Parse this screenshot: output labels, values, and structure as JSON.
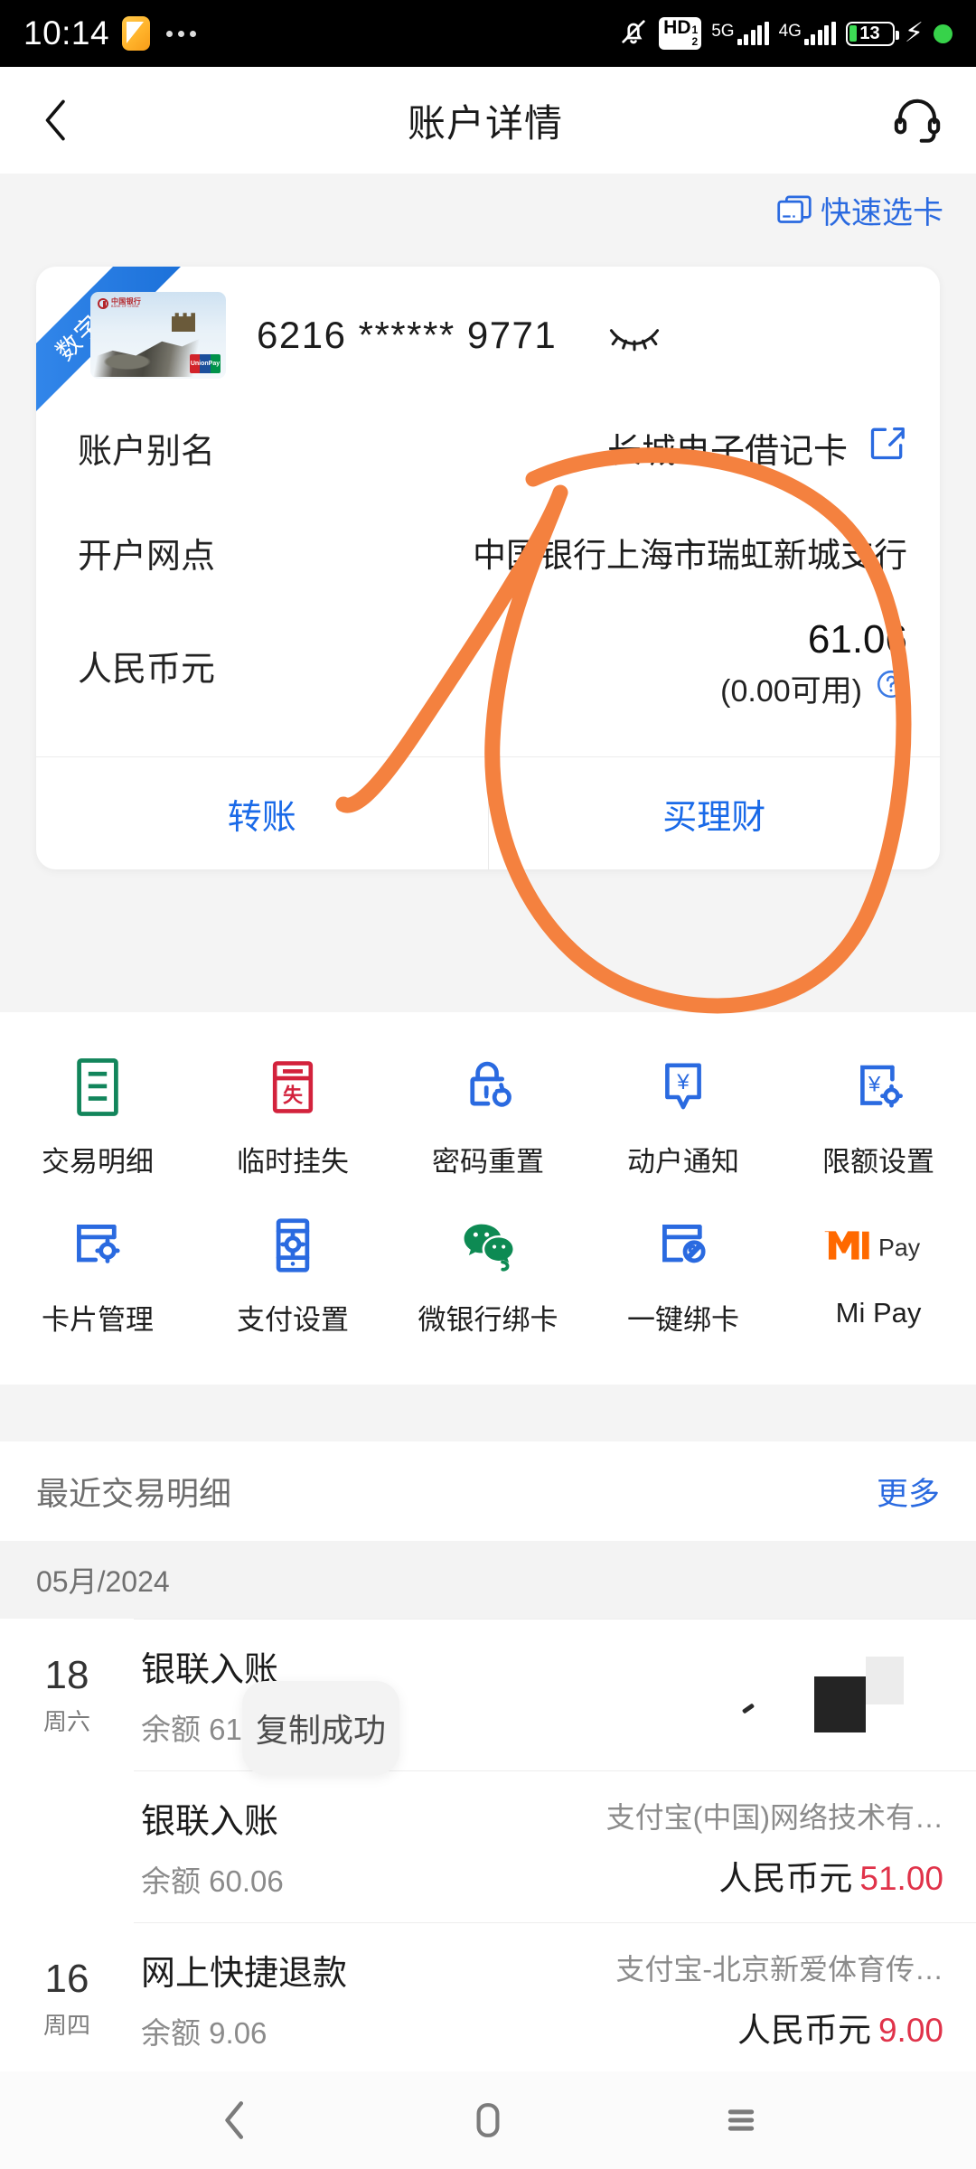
{
  "status_bar": {
    "time": "10:14",
    "app_icon": "note-icon",
    "overflow_dots": "...",
    "silent_icon": "bell-muted-icon",
    "hd_label": "HD",
    "hd_sup": "1",
    "hd_sub": "2",
    "network_1": "5G",
    "network_2": "4G",
    "battery_percent": "13",
    "charging_icon": "bolt-icon",
    "status_dot": "green-dot"
  },
  "header": {
    "back_icon": "back-chevron-icon",
    "title": "账户详情",
    "service_icon": "headset-icon"
  },
  "quick_card": {
    "icon": "card-stack-icon",
    "label": "快速选卡",
    "color": "#2a6ae0"
  },
  "account_card": {
    "ribbon": "数字卡",
    "card_thumb_icon": "boc-great-wall-card-icon",
    "bank_logo_zh": "中国银行",
    "bank_logo_en": "BANK OF CHINA",
    "unionpay_label": "UnionPay",
    "card_number": "6216 ****** 9771",
    "eye_icon": "eye-closed-icon",
    "rows": [
      {
        "label": "账户别名",
        "value": "长城电子借记卡",
        "icon": "edit-pencil-icon"
      },
      {
        "label": "开户网点",
        "value": "中国银行上海市瑞虹新城支行"
      }
    ],
    "balance": {
      "label": "人民币元",
      "amount": "61.06",
      "available": "(0.00可用)",
      "help_icon": "question-circle-icon"
    },
    "actions": [
      {
        "label": "转账"
      },
      {
        "label": "买理财"
      }
    ]
  },
  "function_grid": {
    "rows": [
      [
        {
          "label": "交易明细",
          "icon": "transaction-list-icon",
          "color": "#12855b"
        },
        {
          "label": "临时挂失",
          "icon": "temporary-loss-report-icon",
          "color": "#d3223c"
        },
        {
          "label": "密码重置",
          "icon": "password-reset-lock-icon",
          "color": "#2a6ae0"
        },
        {
          "label": "动户通知",
          "icon": "account-alert-icon",
          "color": "#2a6ae0"
        },
        {
          "label": "限额设置",
          "icon": "limit-settings-icon",
          "color": "#2a6ae0"
        }
      ],
      [
        {
          "label": "卡片管理",
          "icon": "card-management-icon",
          "color": "#2a6ae0"
        },
        {
          "label": "支付设置",
          "icon": "payment-settings-icon",
          "color": "#2a6ae0"
        },
        {
          "label": "微银行绑卡",
          "icon": "wechat-bind-card-icon",
          "color": "#0d8a53"
        },
        {
          "label": "一键绑卡",
          "icon": "one-click-bind-card-icon",
          "color": "#2a6ae0"
        },
        {
          "label": "Mi Pay",
          "icon": "mi-pay-icon",
          "color": "#ff6900",
          "badge": "Pay"
        }
      ]
    ]
  },
  "recent": {
    "title": "最近交易明细",
    "more_label": "更多",
    "month_label": "05月/2024",
    "transactions": [
      {
        "day": "18",
        "weekday": "周六",
        "name": "银联入账",
        "balance": "余额 61.06",
        "payee": "",
        "currency": "",
        "amount": ""
      },
      {
        "day": "",
        "weekday": "",
        "name": "银联入账",
        "balance": "余额 60.06",
        "payee": "支付宝(中国)网络技术有…",
        "currency": "人民币元",
        "amount": "51.00"
      },
      {
        "day": "16",
        "weekday": "周四",
        "name": "网上快捷退款",
        "balance": "余额 9.06",
        "payee": "支付宝-北京新爱体育传…",
        "currency": "人民币元",
        "amount": "9.00"
      }
    ]
  },
  "toast": {
    "message": "复制成功"
  },
  "annotation": {
    "color": "#f4813f",
    "shape": "hand-drawn-circle"
  },
  "nav_bar": {
    "back_icon": "nav-back-icon",
    "home_icon": "nav-home-icon",
    "recents_icon": "nav-recents-icon"
  }
}
